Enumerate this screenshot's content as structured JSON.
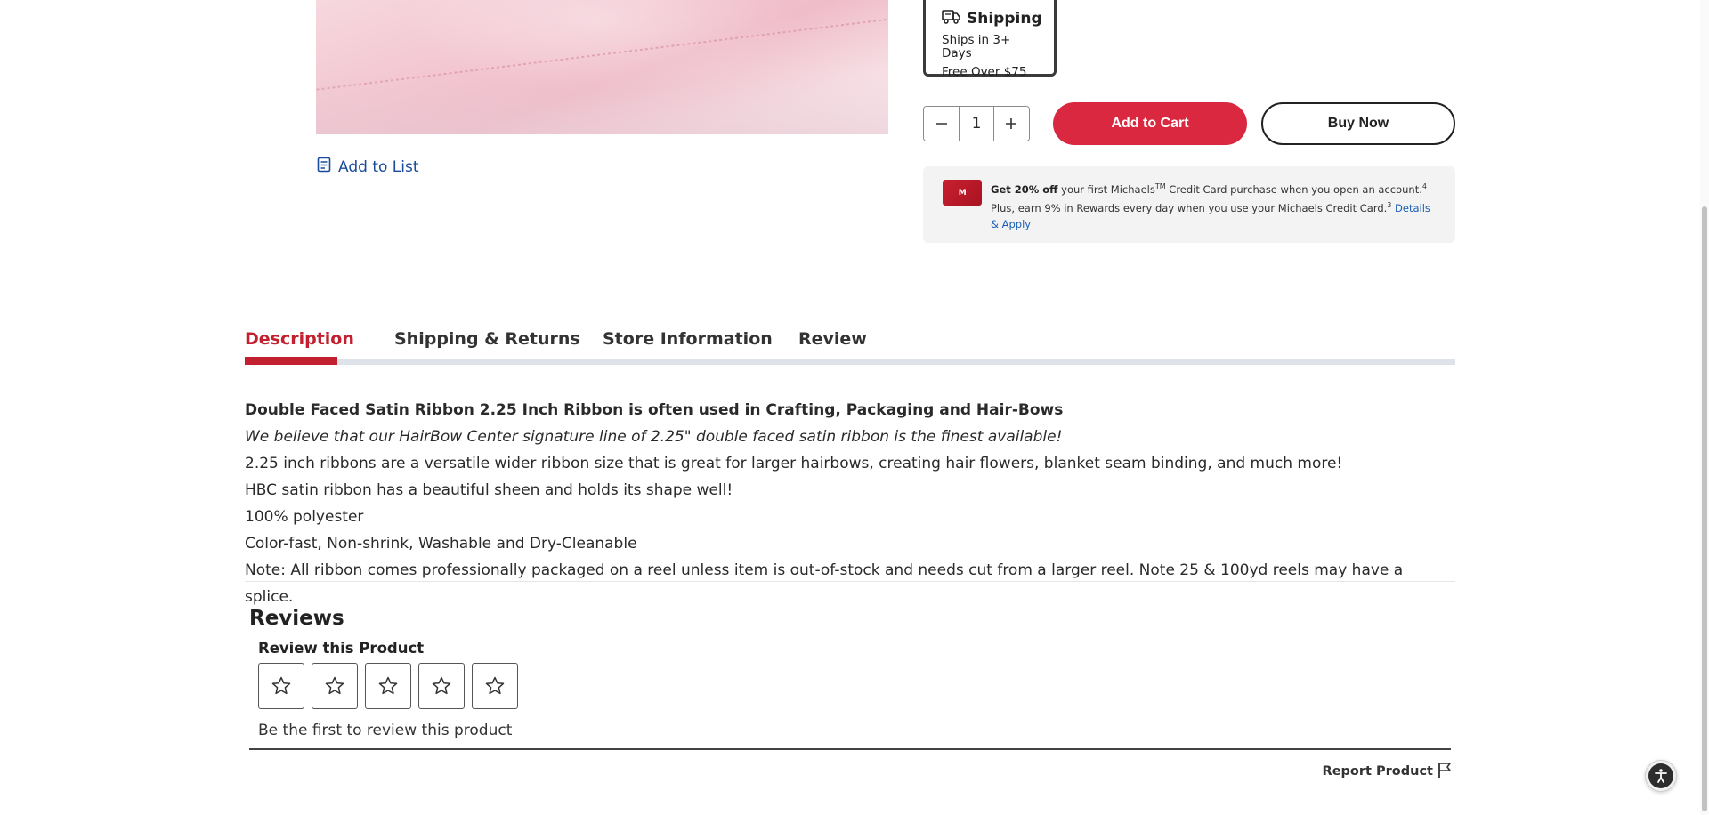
{
  "product": {
    "add_to_list_label": "Add to List"
  },
  "shipping": {
    "title": "Shipping",
    "line1": "Ships in 3+ Days",
    "line2": "Free Over $75"
  },
  "quantity": {
    "value": "1",
    "decrease_symbol": "−",
    "increase_symbol": "+"
  },
  "actions": {
    "add_to_cart": "Add to Cart",
    "buy_now": "Buy Now"
  },
  "promo": {
    "card_label": "M",
    "bold": "Get 20% off",
    "text1": " your first Michaels",
    "tm": "TM",
    "text2": " Credit Card purchase when you open an account.",
    "sup4": "4",
    "text3": " Plus, earn 9% in Rewards every day when you use your Michaels Credit Card.",
    "sup3": "3",
    "link": "Details & Apply"
  },
  "tabs": [
    {
      "label": "Description"
    },
    {
      "label": "Shipping & Returns"
    },
    {
      "label": "Store Information"
    },
    {
      "label": "Review"
    }
  ],
  "description": {
    "heading": "Double Faced Satin Ribbon 2.25 Inch Ribbon is often used in Crafting, Packaging and Hair-Bows",
    "italic": "We believe that our HairBow Center signature line of 2.25\" double faced satin ribbon is the finest available!",
    "lines": [
      "2.25 inch ribbons are a versatile wider ribbon size that is great for larger hairbows, creating hair flowers, blanket seam binding, and much more!",
      "HBC satin ribbon has a beautiful sheen and holds its shape well!",
      "100% polyester",
      "Color-fast, Non-shrink, Washable and Dry-Cleanable",
      "Note: All ribbon comes professionally packaged on a reel unless item is out-of-stock and needs cut from a larger reel. Note 25 & 100yd reels may have a splice."
    ]
  },
  "reviews": {
    "title": "Reviews",
    "review_this": "Review this Product",
    "star_count": 5,
    "first_review": "Be the first to review this product",
    "report": "Report Product"
  },
  "colors": {
    "accent_red": "#d9283f",
    "tab_active": "#c2202e",
    "link_blue": "#1a4b9a"
  }
}
